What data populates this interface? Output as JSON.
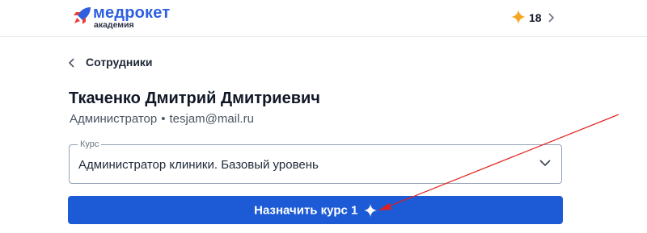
{
  "header": {
    "logo": {
      "name": "медрокет",
      "subtitle": "академия",
      "icon": "rocket-icon"
    },
    "bonus": {
      "icon": "sparkle-icon",
      "count": "18",
      "chevron_icon": "chevron-right-icon"
    }
  },
  "nav": {
    "back_icon": "chevron-left-icon",
    "back_label": "Сотрудники"
  },
  "user": {
    "full_name": "Ткаченко Дмитрий Дмитриевич",
    "role": "Администратор",
    "separator": "•",
    "email": "tesjam@mail.ru"
  },
  "course_select": {
    "label": "Курс",
    "value": "Администратор клиники. Базовый уровень",
    "chevron_icon": "chevron-down-icon"
  },
  "assign_button": {
    "label": "Назначить курс 1",
    "icon": "sparkle-icon"
  },
  "colors": {
    "brand_blue": "#2f5fe0",
    "rocket_red": "#e8413a",
    "sparkle_orange": "#f5a623",
    "button_blue": "#1d5bd6",
    "annotation_red": "#e0201c"
  }
}
